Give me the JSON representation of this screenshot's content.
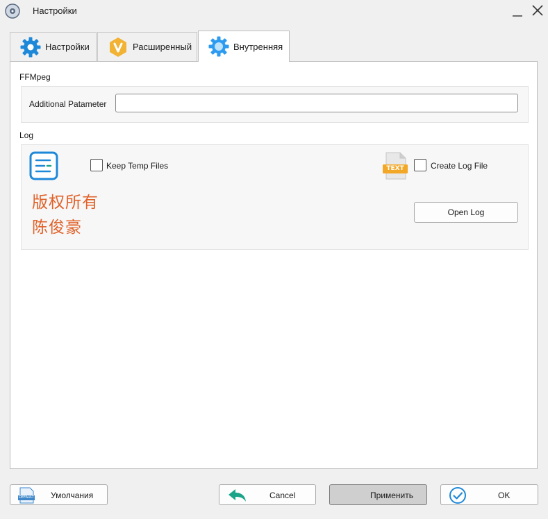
{
  "window": {
    "title": "Настройки"
  },
  "tabs": [
    {
      "label": "Настройки",
      "icon": "gear-icon",
      "color": "#1e88d8"
    },
    {
      "label": "Расширенный",
      "icon": "v-badge-icon",
      "color": "#f2b234"
    },
    {
      "label": "Внутренняя",
      "icon": "gear-icon",
      "color": "#2d9bf0",
      "active": true
    }
  ],
  "ffmpeg": {
    "section_title": "FFMpeg",
    "param_label": "Additional Patameter",
    "param_value": ""
  },
  "log": {
    "section_title": "Log",
    "keep_temp_label": "Keep Temp Files",
    "keep_temp_checked": false,
    "text_badge": "TEXT",
    "create_log_label": "Create Log File",
    "create_log_checked": false,
    "open_log_label": "Open Log",
    "watermark_line1": "版权所有",
    "watermark_line2": "陈俊豪"
  },
  "footer": {
    "defaults_label": "Умолчания",
    "defaults_icon_text": "DEFAULT",
    "cancel_label": "Cancel",
    "apply_label": "Применить",
    "ok_label": "OK"
  },
  "colors": {
    "accent_blue": "#1e88d8",
    "accent_teal": "#1aa58a",
    "watermark": "#e0622a"
  }
}
